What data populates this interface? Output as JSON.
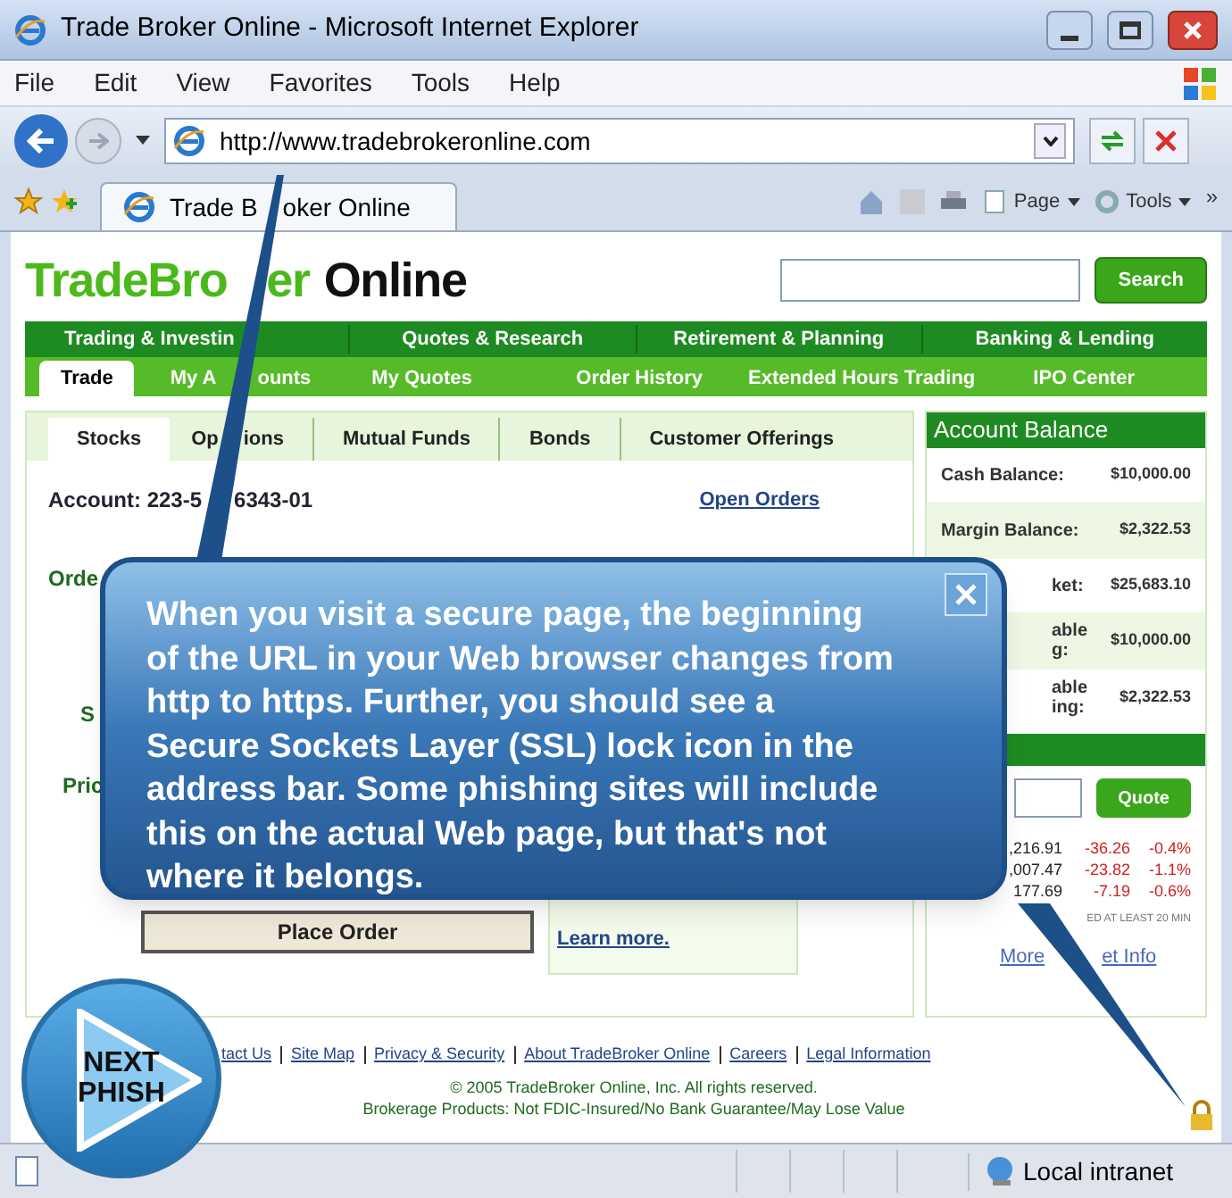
{
  "window": {
    "title": "Trade Broker Online - Microsoft Internet Explorer"
  },
  "menu": [
    "File",
    "Edit",
    "View",
    "Favorites",
    "Tools",
    "Help"
  ],
  "address": {
    "value": "http://www.tradebrokeronline.com"
  },
  "browser_tab": {
    "label": [
      "Trade B",
      "oker Online"
    ]
  },
  "command_bar": {
    "buttons": [
      "Page",
      "Tools"
    ],
    "overflow": "»"
  },
  "site": {
    "logo": [
      "TradeBro",
      "er",
      "Online"
    ],
    "search_button": "Search"
  },
  "nav_primary": [
    "Trading & Investin",
    "Quotes & Research",
    "Retirement & Planning",
    "Banking & Lending"
  ],
  "nav_secondary": [
    {
      "label": [
        "Trade"
      ],
      "selected": true
    },
    {
      "label": [
        "My A",
        "ounts"
      ],
      "selected": false
    },
    {
      "label": [
        "My Quotes"
      ],
      "selected": false
    },
    {
      "label": [
        "Order History"
      ],
      "selected": false
    },
    {
      "label": [
        "Extended Hours Trading"
      ],
      "selected": false
    },
    {
      "label": [
        "IPO Center"
      ],
      "selected": false
    }
  ],
  "subtabs": [
    {
      "label": [
        "Stocks"
      ],
      "selected": true
    },
    {
      "label": [
        "Op",
        "ions"
      ],
      "selected": false
    },
    {
      "label": [
        "Mutual Funds"
      ],
      "selected": false
    },
    {
      "label": [
        "Bonds"
      ],
      "selected": false
    },
    {
      "label": [
        "Customer Offerings"
      ],
      "selected": false
    }
  ],
  "account": {
    "label": "Account: 223-5",
    "rest": "6343-01",
    "open_orders": "Open Orders"
  },
  "order_fragments": [
    "Orde",
    "S",
    "Pric"
  ],
  "place_order": "Place Order",
  "learn_more": "Learn more.",
  "balance": {
    "title": "Account Balance",
    "rows": [
      {
        "label": [
          "Cash Balance:"
        ],
        "value": "$10,000.00"
      },
      {
        "label": [
          "Margin Balance:"
        ],
        "value": "$2,322.53"
      },
      {
        "label": [
          "ket:"
        ],
        "value": "$25,683.10"
      },
      {
        "label": [
          "able",
          "g:"
        ],
        "value": "$10,000.00"
      },
      {
        "label": [
          "able",
          "ing:"
        ],
        "value": "$2,322.53"
      }
    ]
  },
  "quote_button": "Quote",
  "indices": [
    {
      "value": ",216.91",
      "change": "-36.26",
      "percent": "-0.4%"
    },
    {
      "value": ",007.47",
      "change": "-23.82",
      "percent": "-1.1%"
    },
    {
      "value": "177.69",
      "change": "-7.19",
      "percent": "-0.6%"
    }
  ],
  "delay_note": "ED AT LEAST 20 MIN",
  "market_link": [
    "More",
    "et Info"
  ],
  "footer": {
    "links": [
      "tact Us",
      "Site Map",
      "Privacy & Security",
      "About TradeBroker Online",
      "Careers",
      "Legal Information"
    ],
    "copyright": "© 2005 TradeBroker Online, Inc. All rights reserved.",
    "disclaimer": "Brokerage Products: Not FDIC-Insured/No Bank Guarantee/May Lose Value"
  },
  "callout": {
    "lines": [
      "When you visit a secure page, the beginning",
      "of the URL in your Web browser changes from",
      "http to https. Further, you should see a",
      "Secure Sockets Layer (SSL) lock icon in the",
      "address bar. Some phishing sites will include",
      "this on the actual Web page, but that's not",
      "where it belongs."
    ]
  },
  "next_button": [
    "NEXT",
    "PHISH"
  ],
  "status_bar": {
    "zone": "Local intranet"
  }
}
